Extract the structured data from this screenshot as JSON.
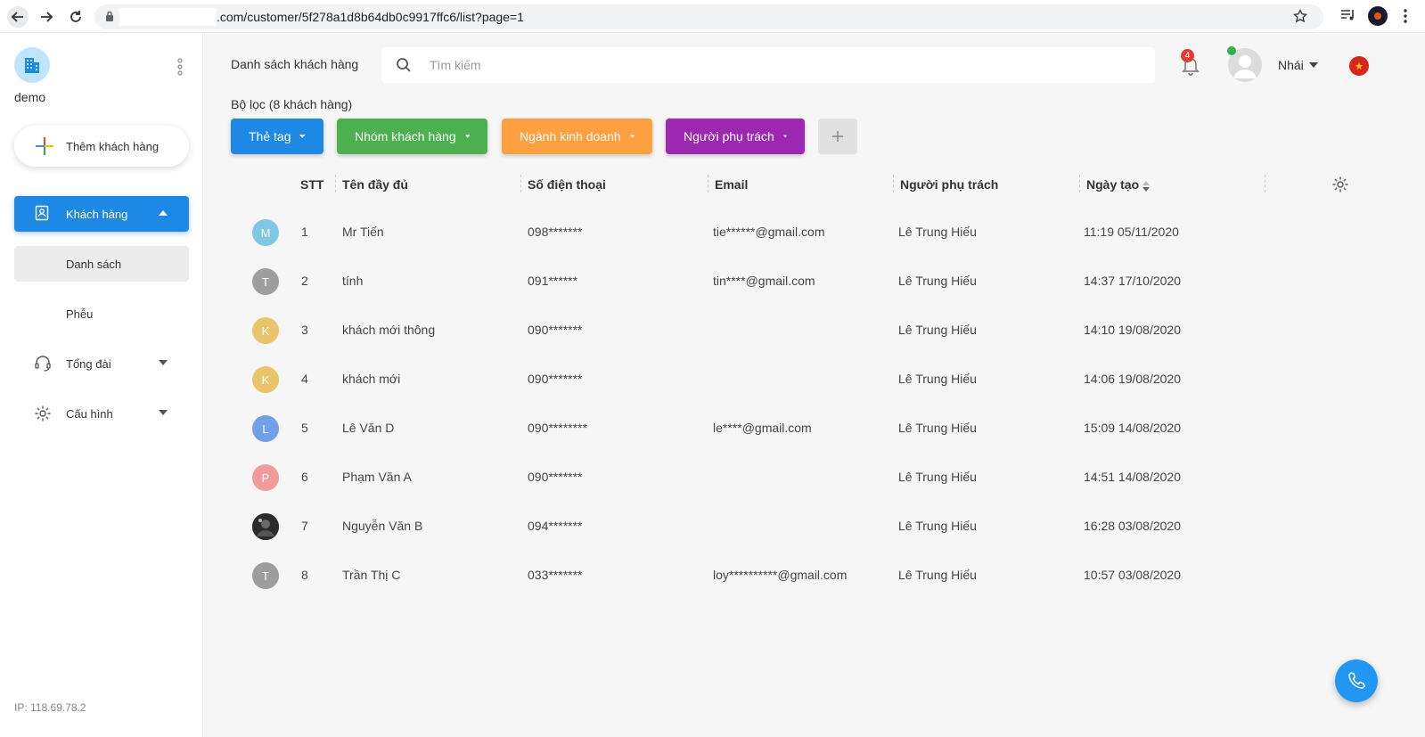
{
  "browser": {
    "url": ".com/customer/5f278a1d8b64db0c9917ffc6/list?page=1"
  },
  "sidebar": {
    "org_name": "demo",
    "add_customer_label": "Thêm khách hàng",
    "menu": {
      "customers": "Khách hàng",
      "list": "Danh sách",
      "funnel": "Phễu",
      "switchboard": "Tổng đài",
      "settings": "Cấu hình"
    },
    "ip": "IP: 118.69.78.2"
  },
  "header": {
    "page_title": "Danh sách khách hàng",
    "search_placeholder": "Tìm kiếm",
    "notification_count": "4",
    "user_name": "Nhái"
  },
  "filters": {
    "title": "Bộ lọc (8 khách hàng)",
    "chips": [
      "Thẻ tag",
      "Nhóm khách hàng",
      "Ngành kinh doanh",
      "Người phụ trách"
    ]
  },
  "table": {
    "columns": [
      "STT",
      "Tên đầy đủ",
      "Số điện thoại",
      "Email",
      "Người phụ trách",
      "Ngày tạo"
    ],
    "rows": [
      {
        "avatar": "M",
        "avatar_color": "#7ec8e3",
        "stt": "1",
        "name": "Mr Tiến",
        "phone": "098*******",
        "email": "tie******@gmail.com",
        "owner": "Lê Trung Hiếu",
        "created": "11:19 05/11/2020"
      },
      {
        "avatar": "T",
        "avatar_color": "#9e9e9e",
        "stt": "2",
        "name": "tính",
        "phone": "091******",
        "email": "tin****@gmail.com",
        "owner": "Lê Trung Hiếu",
        "created": "14:37 17/10/2020"
      },
      {
        "avatar": "K",
        "avatar_color": "#e9c46a",
        "stt": "3",
        "name": "khách mới thông",
        "phone": "090*******",
        "email": "",
        "owner": "Lê Trung Hiếu",
        "created": "14:10 19/08/2020"
      },
      {
        "avatar": "K",
        "avatar_color": "#e9c46a",
        "stt": "4",
        "name": "khách mới",
        "phone": "090*******",
        "email": "",
        "owner": "Lê Trung Hiếu",
        "created": "14:06 19/08/2020"
      },
      {
        "avatar": "L",
        "avatar_color": "#6fa1e8",
        "stt": "5",
        "name": "Lê Văn D",
        "phone": "090********",
        "email": "le****@gmail.com",
        "owner": "Lê Trung Hiếu",
        "created": "15:09 14/08/2020"
      },
      {
        "avatar": "P",
        "avatar_color": "#f09a9a",
        "stt": "6",
        "name": "Phạm Văn A",
        "phone": "090*******",
        "email": "",
        "owner": "Lê Trung Hiếu",
        "created": "14:51 14/08/2020"
      },
      {
        "avatar": "",
        "avatar_color": "#2b2b2b",
        "stt": "7",
        "name": "Nguyễn Văn B",
        "phone": "094*******",
        "email": "",
        "owner": "Lê Trung Hiếu",
        "created": "16:28 03/08/2020"
      },
      {
        "avatar": "T",
        "avatar_color": "#9e9e9e",
        "stt": "8",
        "name": "Trần Thị C",
        "phone": "033*******",
        "email": "loy**********@gmail.com",
        "owner": "Lê Trung Hiếu",
        "created": "10:57 03/08/2020"
      }
    ]
  },
  "colors": {
    "primary": "#1e88e5",
    "tag_chip": "#1e88e5",
    "group_chip": "#4caf50",
    "industry_chip": "#ffa040",
    "owner_chip": "#9c27b0"
  }
}
